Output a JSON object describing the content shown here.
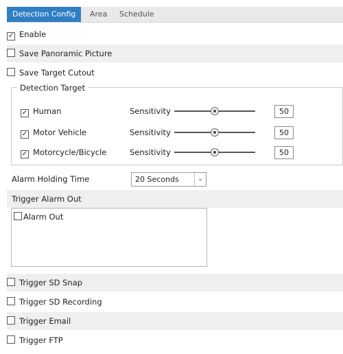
{
  "tabs": [
    {
      "label": "Detection Config",
      "active": true
    },
    {
      "label": "Area",
      "active": false
    },
    {
      "label": "Schedule",
      "active": false
    }
  ],
  "enable": {
    "label": "Enable",
    "checked": true
  },
  "save_panoramic": {
    "label": "Save Panoramic Picture",
    "checked": false
  },
  "save_target_cutout": {
    "label": "Save Target Cutout",
    "checked": false
  },
  "detection_target": {
    "legend": "Detection Target",
    "sensitivity_label": "Sensitivity",
    "items": [
      {
        "label": "Human",
        "checked": true,
        "value": "50"
      },
      {
        "label": "Motor Vehicle",
        "checked": true,
        "value": "50"
      },
      {
        "label": "Motorcycle/Bicycle",
        "checked": true,
        "value": "50"
      }
    ]
  },
  "alarm_holding": {
    "label": "Alarm Holding Time",
    "value": "20 Seconds"
  },
  "trigger_alarm_out": {
    "label": "Trigger Alarm Out",
    "items": [
      {
        "label": "Alarm Out",
        "checked": false
      }
    ]
  },
  "trigger_sd_snap": {
    "label": "Trigger SD Snap",
    "checked": false
  },
  "trigger_sd_recording": {
    "label": "Trigger SD Recording",
    "checked": false
  },
  "trigger_email": {
    "label": "Trigger Email",
    "checked": false
  },
  "trigger_ftp": {
    "label": "Trigger FTP",
    "checked": false
  },
  "icons": {
    "check": "✓",
    "dropdown": "⌄"
  }
}
